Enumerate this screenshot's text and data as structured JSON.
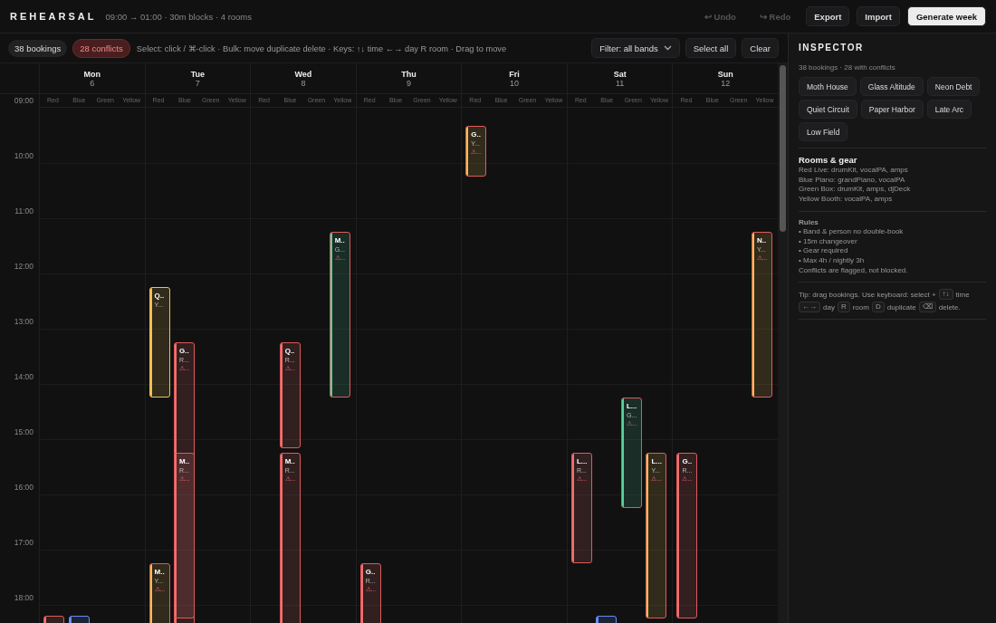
{
  "app": {
    "title": "REHEARSAL",
    "subtitle": "09:00 → 01:00 · 30m blocks · 4 rooms"
  },
  "actions": [
    {
      "label": "↩ Undo",
      "kind": "plain",
      "disabled": true
    },
    {
      "label": "↪ Redo",
      "kind": "plain",
      "disabled": true
    },
    {
      "label": "Export",
      "kind": "default",
      "disabled": false
    },
    {
      "label": "Import",
      "kind": "default",
      "disabled": false
    },
    {
      "label": "Generate week",
      "kind": "primary",
      "disabled": false
    }
  ],
  "toolbar": {
    "chips": [
      {
        "label": "38 bookings",
        "kind": "count"
      },
      {
        "label": "28 conflicts",
        "kind": "alert"
      }
    ],
    "hint": "Select: click / ⌘-click · Bulk: move duplicate delete · Keys: ↑↓ time ←→ day R room · Drag to move",
    "filter": "Filter: all bands",
    "buttons": [
      "Select all",
      "Clear"
    ]
  },
  "calendar": {
    "hours": [
      "09:00",
      "10:00",
      "11:00",
      "12:00",
      "13:00",
      "14:00",
      "15:00",
      "16:00",
      "17:00",
      "18:00"
    ],
    "days": [
      {
        "name": "Mon",
        "date": "6",
        "rooms": [
          "Red",
          "Blue",
          "Green",
          "Yellow"
        ],
        "bookings": [
          {
            "color": "#f07070",
            "conflict": true
          },
          {
            "color": "#6b8cf0",
            "conflict": false
          }
        ]
      },
      {
        "name": "Tue",
        "date": "7",
        "rooms": [
          "Red",
          "Blue",
          "Green",
          "Yellow"
        ],
        "bookings": [
          {
            "color": "#f0c050",
            "conflict": false,
            "title": "Q..",
            "room": "Y..."
          },
          {
            "color": "#f07070",
            "conflict": true,
            "title": "G..",
            "room": "R...",
            "alert": "⚠..."
          },
          {
            "color": "#f07070",
            "conflict": true,
            "title": "M..",
            "room": "R...",
            "alert": "⚠..."
          },
          {
            "color": "#f0c050",
            "conflict": true,
            "title": "M..",
            "room": "Y...",
            "alert": "⚠..."
          }
        ]
      },
      {
        "name": "Wed",
        "date": "8",
        "rooms": [
          "Red",
          "Blue",
          "Green",
          "Yellow"
        ],
        "bookings": [
          {
            "color": "#f07070",
            "conflict": true,
            "title": "Q..",
            "room": "R...",
            "alert": "⚠..."
          },
          {
            "color": "#f07070",
            "conflict": true,
            "title": "M..",
            "room": "R...",
            "alert": "⚠..."
          },
          {
            "color": "#4fd6a0",
            "conflict": true,
            "title": "M..",
            "room": "G...",
            "alert": "⚠..."
          }
        ]
      },
      {
        "name": "Thu",
        "date": "9",
        "rooms": [
          "Red",
          "Blue",
          "Green",
          "Yellow"
        ],
        "bookings": [
          {
            "color": "#f07070",
            "conflict": true,
            "title": "G..",
            "room": "R...",
            "alert": "⚠..."
          }
        ]
      },
      {
        "name": "Fri",
        "date": "10",
        "rooms": [
          "Red",
          "Blue",
          "Green",
          "Yellow"
        ],
        "bookings": [
          {
            "color": "#f0c050",
            "conflict": true,
            "title": "G..",
            "room": "Y...",
            "alert": "⚠..."
          }
        ]
      },
      {
        "name": "Sat",
        "date": "11",
        "rooms": [
          "Red",
          "Blue",
          "Green",
          "Yellow"
        ],
        "bookings": [
          {
            "color": "#f07070",
            "conflict": true,
            "title": "L...",
            "room": "R...",
            "alert": "⚠..."
          },
          {
            "color": "#6b8cf0",
            "conflict": false
          },
          {
            "color": "#4fd6a0",
            "conflict": true,
            "title": "L...",
            "room": "G...",
            "alert": "⚠..."
          },
          {
            "color": "#f0c050",
            "conflict": true,
            "title": "L...",
            "room": "Y...",
            "alert": "⚠..."
          }
        ]
      },
      {
        "name": "Sun",
        "date": "12",
        "rooms": [
          "Red",
          "Blue",
          "Green",
          "Yellow"
        ],
        "bookings": [
          {
            "color": "#f07070",
            "conflict": true,
            "title": "G..",
            "room": "R...",
            "alert": "⚠..."
          },
          {
            "color": "#f0c050",
            "conflict": true,
            "title": "N..",
            "room": "Y...",
            "alert": "⚠..."
          }
        ]
      }
    ]
  },
  "inspector": {
    "title": "INSPECTOR",
    "summary": "38 bookings · 28 with conflicts",
    "bands": [
      "Moth House",
      "Glass Altitude",
      "Neon Debt",
      "Quiet Circuit",
      "Paper Harbor",
      "Late Arc",
      "Low Field"
    ],
    "gear_title": "Rooms & gear",
    "gear": [
      "Red Live: drumKit, vocalPA, amps",
      "Blue Piano: grandPiano, vocalPA",
      "Green Box: drumKit, amps, djDeck",
      "Yellow Booth: vocalPA, amps"
    ],
    "rules_title": "Rules",
    "rules": [
      "• Band & person no double-book",
      "• 15m changeover",
      "• Gear required",
      "• Max 4h / nightly 3h",
      "Conflicts are flagged, not blocked."
    ],
    "tip": [
      {
        "kind": "text",
        "text": "Tip: drag bookings. Use keyboard: select +"
      },
      {
        "kind": "key",
        "text": "↑↓"
      },
      {
        "kind": "text",
        "text": "time"
      },
      {
        "kind": "key",
        "text": "←→"
      },
      {
        "kind": "text",
        "text": "day"
      },
      {
        "kind": "key",
        "text": "R"
      },
      {
        "kind": "text",
        "text": "room"
      },
      {
        "kind": "key",
        "text": "D"
      },
      {
        "kind": "text",
        "text": "duplicate"
      },
      {
        "kind": "key",
        "text": "⌫"
      },
      {
        "kind": "text",
        "text": "delete."
      }
    ]
  }
}
